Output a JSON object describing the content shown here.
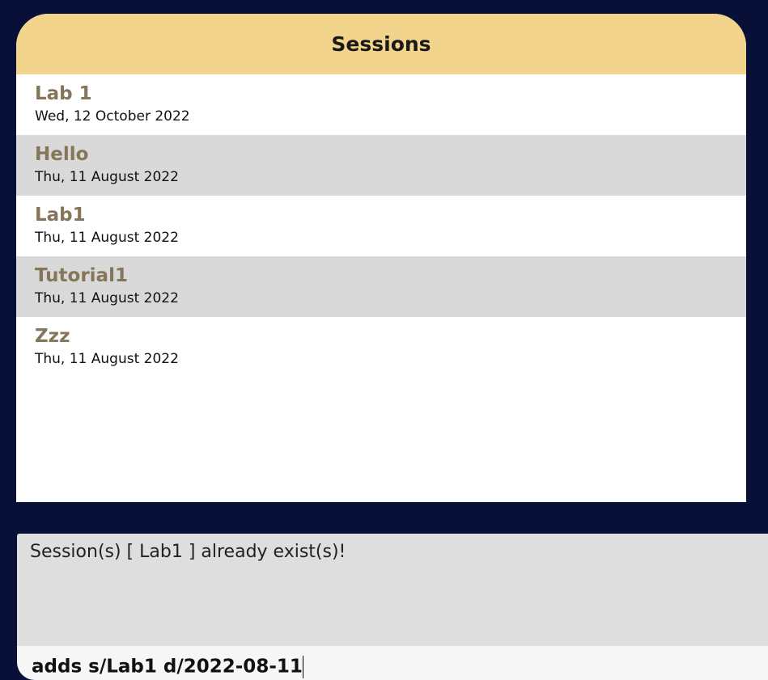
{
  "sessions_panel": {
    "title": "Sessions",
    "items": [
      {
        "name": "Lab 1",
        "date": "Wed, 12 October 2022"
      },
      {
        "name": "Hello",
        "date": "Thu, 11 August 2022"
      },
      {
        "name": "Lab1",
        "date": "Thu, 11 August 2022"
      },
      {
        "name": "Tutorial1",
        "date": "Thu, 11 August 2022"
      },
      {
        "name": "Zzz",
        "date": "Thu, 11 August 2022"
      }
    ]
  },
  "result_display": {
    "message": "Session(s) [ Lab1 ] already exist(s)!"
  },
  "command_box": {
    "value": "adds s/Lab1 d/2022-08-11"
  }
}
